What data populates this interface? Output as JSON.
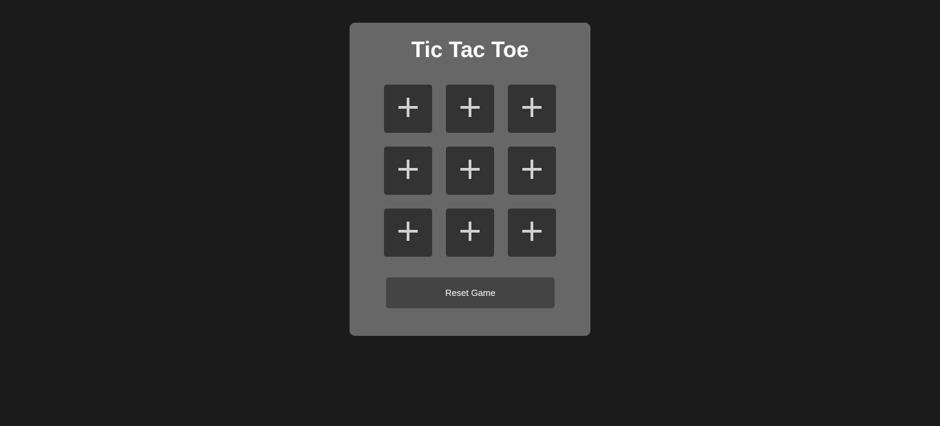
{
  "game": {
    "title": "Tic Tac Toe",
    "reset_label": "Reset Game",
    "board": [
      [
        "",
        "",
        ""
      ],
      [
        "",
        "",
        ""
      ],
      [
        "",
        "",
        ""
      ]
    ],
    "empty_cell_icon": "plus-icon"
  },
  "colors": {
    "page_background": "#1b1b1b",
    "card_background": "#676767",
    "cell_background": "#333333",
    "cell_icon": "#cfcfcf",
    "button_background": "#444444",
    "text": "#ffffff"
  }
}
